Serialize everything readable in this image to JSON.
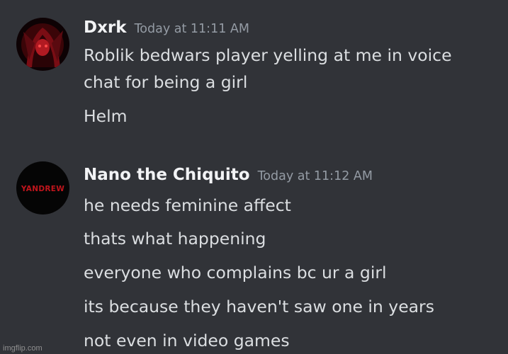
{
  "messages": [
    {
      "username": "Dxrk",
      "timestamp": "Today at 11:11 AM",
      "avatar_icon": "anime-avatar-red-icon",
      "lines": [
        "Roblik bedwars player yelling at me in voice",
        "chat for being a girl",
        "Helm"
      ]
    },
    {
      "username": "Nano the Chiquito",
      "timestamp": "Today at 11:12 AM",
      "avatar_icon": "yandrew-logo-avatar-icon",
      "avatar_text": "YANDREW",
      "lines": [
        "he needs feminine affect",
        "thats what happening",
        "everyone who complains bc ur a girl",
        "its because they haven't saw one in years",
        "not even in video games"
      ]
    }
  ],
  "watermark": "imgflip.com",
  "colors": {
    "background": "#313338",
    "username": "#f2f3f5",
    "timestamp": "#949ba4",
    "message_text": "#dbdee1"
  }
}
